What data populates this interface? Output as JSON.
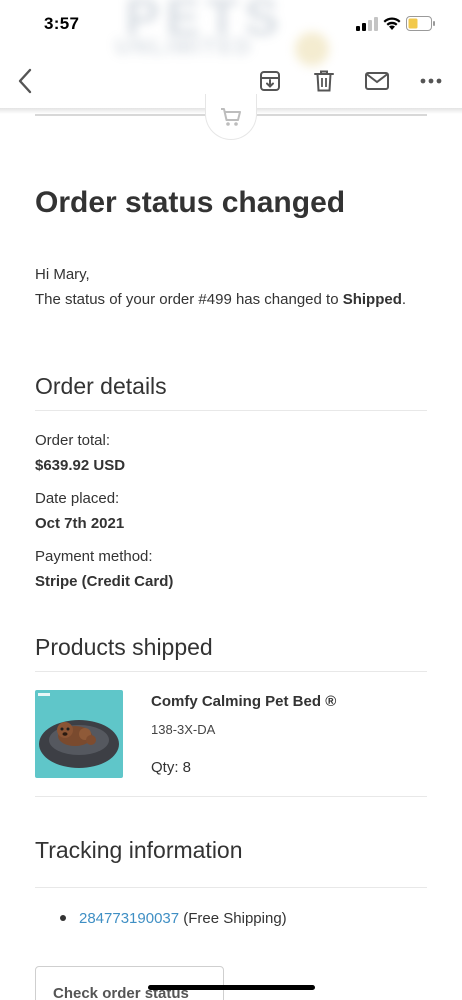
{
  "status_bar": {
    "time": "3:57"
  },
  "toolbar": {
    "back": "back",
    "archive": "archive",
    "trash": "trash",
    "mail": "mail",
    "more": "more"
  },
  "email": {
    "title": "Order status changed",
    "greeting_line": "Hi Mary,",
    "status_prefix": "The status of your order #499 has changed to ",
    "status_value": "Shipped",
    "status_suffix": ".",
    "order_details": {
      "heading": "Order details",
      "order_total_label": "Order total:",
      "order_total_value": "$639.92 USD",
      "date_label": "Date placed:",
      "date_value": "Oct 7th 2021",
      "payment_label": "Payment method:",
      "payment_value": "Stripe (Credit Card)"
    },
    "products": {
      "heading": "Products shipped",
      "items": [
        {
          "name": "Comfy Calming Pet Bed ®",
          "sku": "138-3X-DA",
          "qty": "Qty: 8"
        }
      ]
    },
    "tracking": {
      "heading": "Tracking information",
      "number": "284773190037",
      "note": " (Free Shipping)"
    },
    "check_button": "Check order status"
  },
  "colors": {
    "link": "#3f8fc4",
    "text": "#333333",
    "product_bg": "#5fc6c9"
  }
}
